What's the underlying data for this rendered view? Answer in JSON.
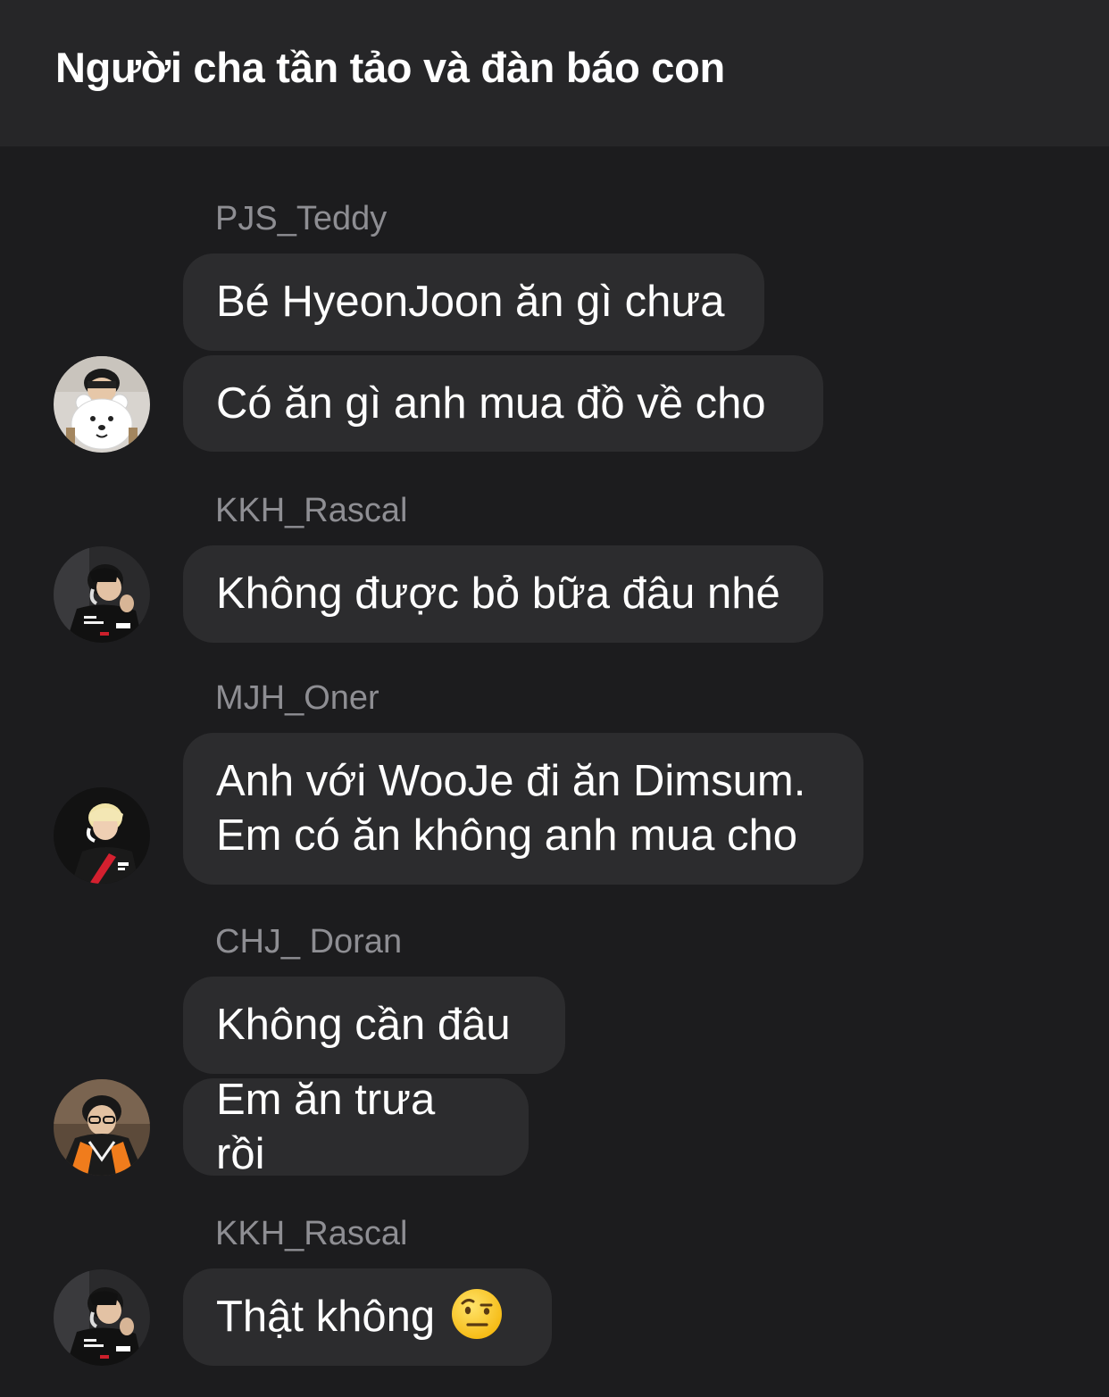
{
  "chat": {
    "title": "Người cha tần tảo và đàn báo con"
  },
  "messages": {
    "g1": {
      "sender": "PJS_Teddy",
      "m1": "Bé HyeonJoon ăn gì chưa",
      "m2": "Có ăn gì anh mua đồ về cho",
      "avatar_icon": "avatar-pjs-teddy-with-bear-plush"
    },
    "g2": {
      "sender": "KKH_Rascal",
      "m1": "Không được bỏ bữa đâu nhé",
      "avatar_icon": "avatar-kkh-rascal"
    },
    "g3": {
      "sender": "MJH_Oner",
      "m1": "Anh với WooJe đi ăn Dimsum.\nEm có ăn không anh mua cho",
      "avatar_icon": "avatar-mjh-oner"
    },
    "g4": {
      "sender": "CHJ_ Doran",
      "m1": "Không cần đâu",
      "m2": "Em ăn trưa rồi",
      "avatar_icon": "avatar-chj-doran"
    },
    "g5": {
      "sender": "KKH_Rascal",
      "m1": "Thật không",
      "emoji": "face-with-raised-eyebrow",
      "avatar_icon": "avatar-kkh-rascal"
    }
  },
  "colors": {
    "background": "#1c1c1e",
    "header": "#262628",
    "bubble": "#2c2c2e",
    "sender_text": "#8e8e93",
    "message_text": "#ffffff"
  }
}
